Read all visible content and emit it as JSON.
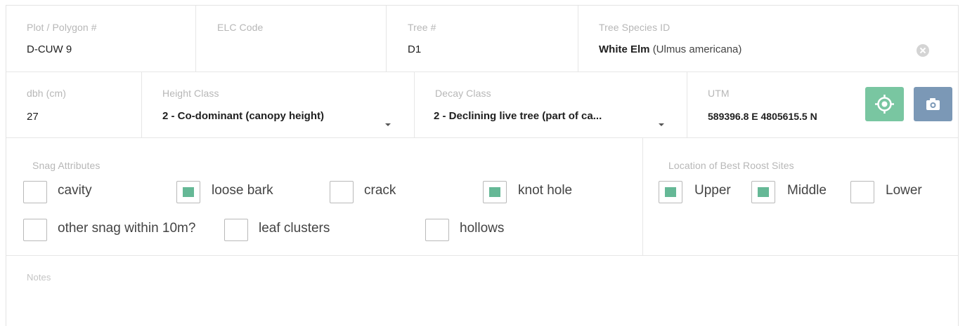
{
  "row1": {
    "plot": {
      "label": "Plot / Polygon #",
      "value": "D-CUW 9"
    },
    "elc": {
      "label": "ELC Code",
      "value": ""
    },
    "tree": {
      "label": "Tree #",
      "value": "D1"
    },
    "species": {
      "label": "Tree Species ID",
      "common": "White Elm",
      "latin": "(Ulmus americana)"
    }
  },
  "row2": {
    "dbh": {
      "label": "dbh (cm)",
      "value": "27"
    },
    "height": {
      "label": "Height Class",
      "value": "2 - Co-dominant (canopy height)"
    },
    "decay": {
      "label": "Decay Class",
      "value": "2 - Declining live tree (part of ca..."
    },
    "utm": {
      "label": "UTM",
      "value": "589396.8 E  4805615.5 N"
    }
  },
  "snag": {
    "label": "Snag Attributes",
    "items": [
      {
        "label": "cavity",
        "checked": false
      },
      {
        "label": "loose bark",
        "checked": true
      },
      {
        "label": "crack",
        "checked": false
      },
      {
        "label": "knot hole",
        "checked": true
      },
      {
        "label": "other snag within 10m?",
        "checked": false
      },
      {
        "label": "leaf clusters",
        "checked": false
      },
      {
        "label": "hollows",
        "checked": false
      }
    ]
  },
  "roost": {
    "label": "Location of Best Roost Sites",
    "items": [
      {
        "label": "Upper",
        "checked": true
      },
      {
        "label": "Middle",
        "checked": true
      },
      {
        "label": "Lower",
        "checked": false
      }
    ]
  },
  "notes": {
    "label": "Notes",
    "value": ""
  },
  "colors": {
    "accent_green": "#79c6a1",
    "camera_blue": "#7b98b6",
    "check_fill": "#65b896"
  },
  "icons": [
    "clear-icon",
    "location-target-icon",
    "camera-icon",
    "dropdown-caret-icon"
  ]
}
